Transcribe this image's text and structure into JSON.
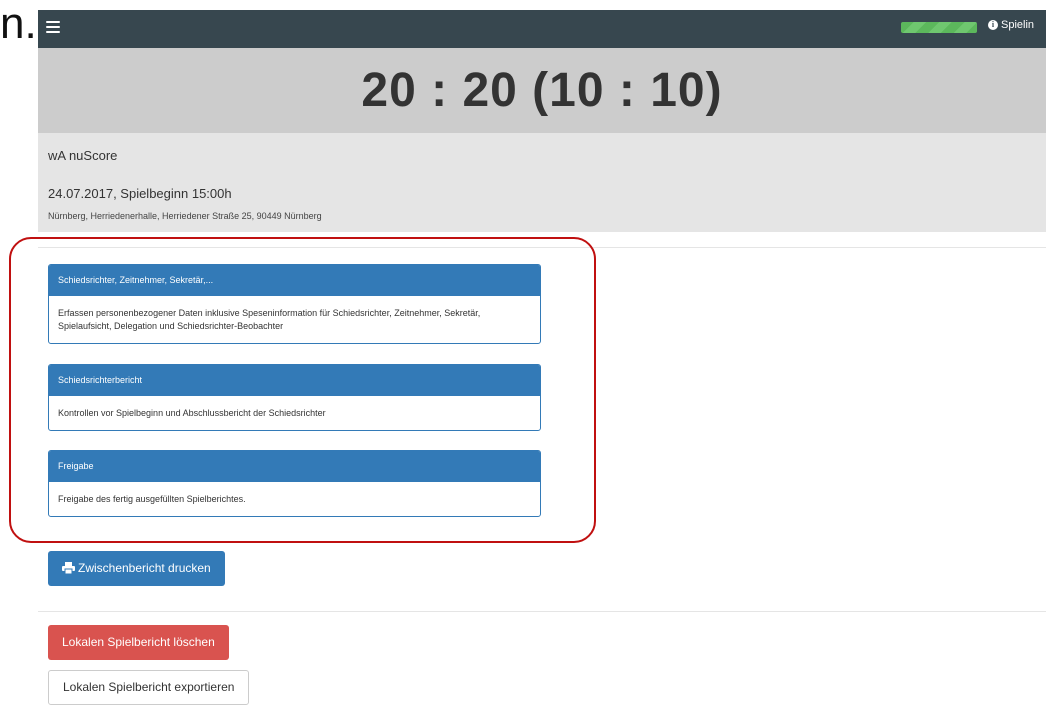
{
  "corner_text": "n.",
  "navbar": {
    "menu_icon": "hamburger-icon",
    "progress_value": 1.0,
    "progress_color": "#5cb85c",
    "info_icon": "info-circle-icon",
    "info_label": "Spielin"
  },
  "score": {
    "text": "20 : 20 (10 : 10)"
  },
  "match": {
    "team": "wA nuScore",
    "date": "24.07.2017, Spielbeginn 15:00h",
    "venue": "Nürnberg, Herriedenerhalle, Herriedener Straße 25, 90449 Nürnberg"
  },
  "panels": [
    {
      "title": "Schiedsrichter, Zeitnehmer, Sekretär,...",
      "body": "Erfassen personenbezogener Daten inklusive Speseninformation für Schiedsrichter, Zeitnehmer, Sekretär, Spielaufsicht, Delegation und Schiedsrichter-Beobachter"
    },
    {
      "title": "Schiedsrichterbericht",
      "body": "Kontrollen vor Spielbeginn und Abschlussbericht der Schiedsrichter"
    },
    {
      "title": "Freigabe",
      "body": "Freigabe des fertig ausgefüllten Spielberichtes."
    }
  ],
  "buttons": {
    "print_icon": "printer-icon",
    "print_label": "Zwischenbericht drucken",
    "delete_label": "Lokalen Spielbericht löschen",
    "export_label": "Lokalen Spielbericht exportieren"
  },
  "colors": {
    "navbar": "#37474f",
    "primary": "#337ab7",
    "danger": "#d9534f",
    "score_band": "#cccccc",
    "info_band": "#e5e5e5",
    "highlight": "#c01010"
  }
}
